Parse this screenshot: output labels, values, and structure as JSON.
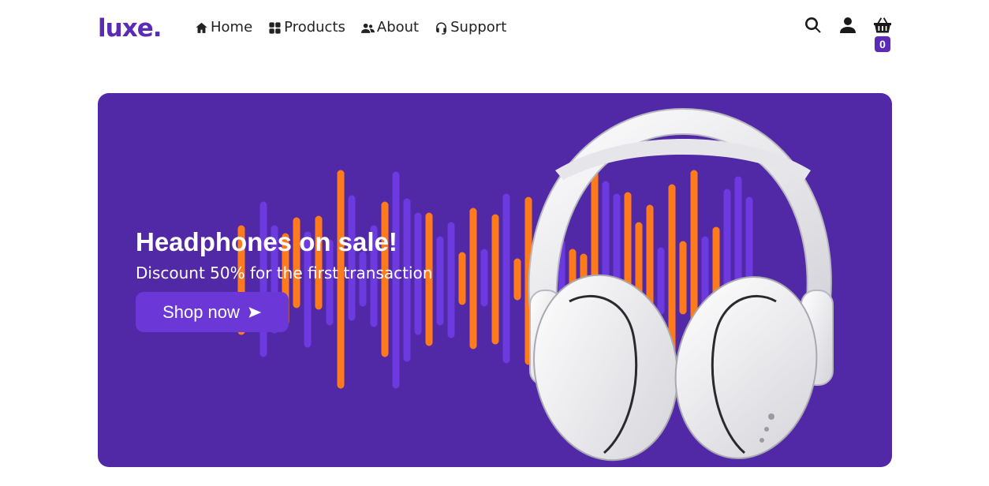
{
  "brand": {
    "name": "luxe.",
    "color": "#5b2bb5"
  },
  "nav": {
    "items": [
      {
        "label": "Home",
        "icon": "home-icon"
      },
      {
        "label": "Products",
        "icon": "grid-icon"
      },
      {
        "label": "About",
        "icon": "users-icon"
      },
      {
        "label": "Support",
        "icon": "headset-icon"
      }
    ]
  },
  "actions": {
    "search_icon": "search-icon",
    "account_icon": "user-icon",
    "cart_icon": "basket-icon",
    "cart_count": "0"
  },
  "hero": {
    "title": "Headphones on sale!",
    "subtitle": "Discount 50% for the first transaction",
    "cta_label": "Shop now",
    "cta_icon": "send-arrow-icon",
    "background": "#5128a5",
    "accent_orange": "#ff7a1a",
    "accent_purple": "#6d3ae0"
  }
}
